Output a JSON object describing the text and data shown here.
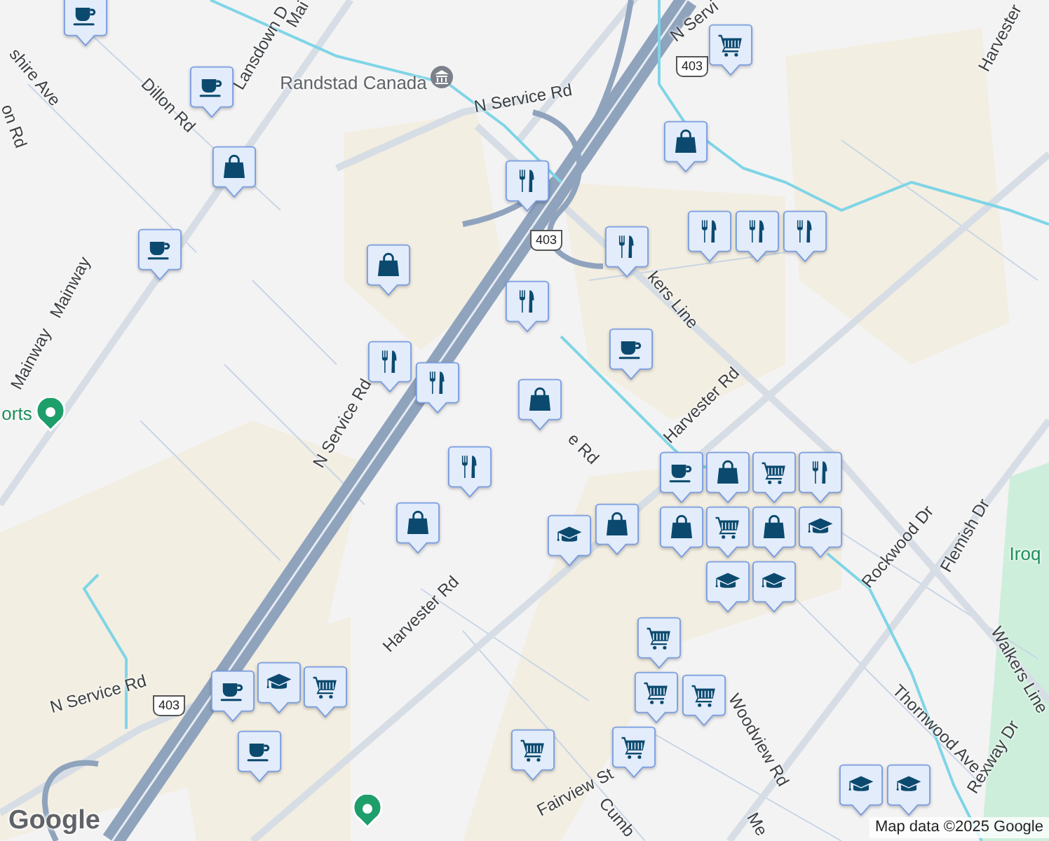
{
  "map": {
    "labels": [
      {
        "text": "shire Ave",
        "kind": "road"
      },
      {
        "text": "Lansdown D",
        "kind": "road"
      },
      {
        "text": "Mai",
        "kind": "road"
      },
      {
        "text": "Dillon Rd",
        "kind": "road"
      },
      {
        "text": "on Rd",
        "kind": "road"
      },
      {
        "text": "Mainway",
        "kind": "road"
      },
      {
        "text": "Mainway",
        "kind": "road"
      },
      {
        "text": "N Service Rd",
        "kind": "road"
      },
      {
        "text": "N Servi",
        "kind": "road"
      },
      {
        "text": "Harvester",
        "kind": "road"
      },
      {
        "text": "kers Line",
        "kind": "road"
      },
      {
        "text": "Harvester Rd",
        "kind": "road"
      },
      {
        "text": "e Rd",
        "kind": "road"
      },
      {
        "text": "N Service Rd",
        "kind": "road"
      },
      {
        "text": "Harvester Rd",
        "kind": "road"
      },
      {
        "text": "N Service Rd",
        "kind": "road"
      },
      {
        "text": "Woodview Rd",
        "kind": "road"
      },
      {
        "text": "Fairview St",
        "kind": "road"
      },
      {
        "text": "Cumb",
        "kind": "road"
      },
      {
        "text": "Me",
        "kind": "road"
      },
      {
        "text": "Rockwood Dr",
        "kind": "road"
      },
      {
        "text": "Thornwood Ave",
        "kind": "road"
      },
      {
        "text": "Flemish Dr",
        "kind": "road"
      },
      {
        "text": "Walkers Line",
        "kind": "road"
      },
      {
        "text": "Rexway Dr",
        "kind": "road"
      },
      {
        "text": "Randstad Canada",
        "kind": "place"
      },
      {
        "text": "orts",
        "kind": "park"
      },
      {
        "text": "Iroq",
        "kind": "park"
      }
    ],
    "highway_shields": [
      "403",
      "403",
      "403"
    ],
    "pois": [
      {
        "kind": "coffee"
      },
      {
        "kind": "coffee"
      },
      {
        "kind": "bag"
      },
      {
        "kind": "coffee"
      },
      {
        "kind": "bag"
      },
      {
        "kind": "cart"
      },
      {
        "kind": "bag"
      },
      {
        "kind": "food"
      },
      {
        "kind": "food"
      },
      {
        "kind": "food"
      },
      {
        "kind": "food"
      },
      {
        "kind": "food"
      },
      {
        "kind": "food"
      },
      {
        "kind": "coffee"
      },
      {
        "kind": "food"
      },
      {
        "kind": "food"
      },
      {
        "kind": "bag"
      },
      {
        "kind": "food"
      },
      {
        "kind": "bag"
      },
      {
        "kind": "bag"
      },
      {
        "kind": "school"
      },
      {
        "kind": "coffee"
      },
      {
        "kind": "bag"
      },
      {
        "kind": "cart"
      },
      {
        "kind": "food"
      },
      {
        "kind": "bag"
      },
      {
        "kind": "cart"
      },
      {
        "kind": "bag"
      },
      {
        "kind": "school"
      },
      {
        "kind": "school"
      },
      {
        "kind": "school"
      },
      {
        "kind": "cart"
      },
      {
        "kind": "cart"
      },
      {
        "kind": "cart"
      },
      {
        "kind": "cart"
      },
      {
        "kind": "cart"
      },
      {
        "kind": "school"
      },
      {
        "kind": "coffee"
      },
      {
        "kind": "cart"
      },
      {
        "kind": "coffee"
      },
      {
        "kind": "school"
      },
      {
        "kind": "school"
      }
    ],
    "footer": {
      "logo": "Google",
      "attribution": "Map data ©2025 Google"
    }
  }
}
